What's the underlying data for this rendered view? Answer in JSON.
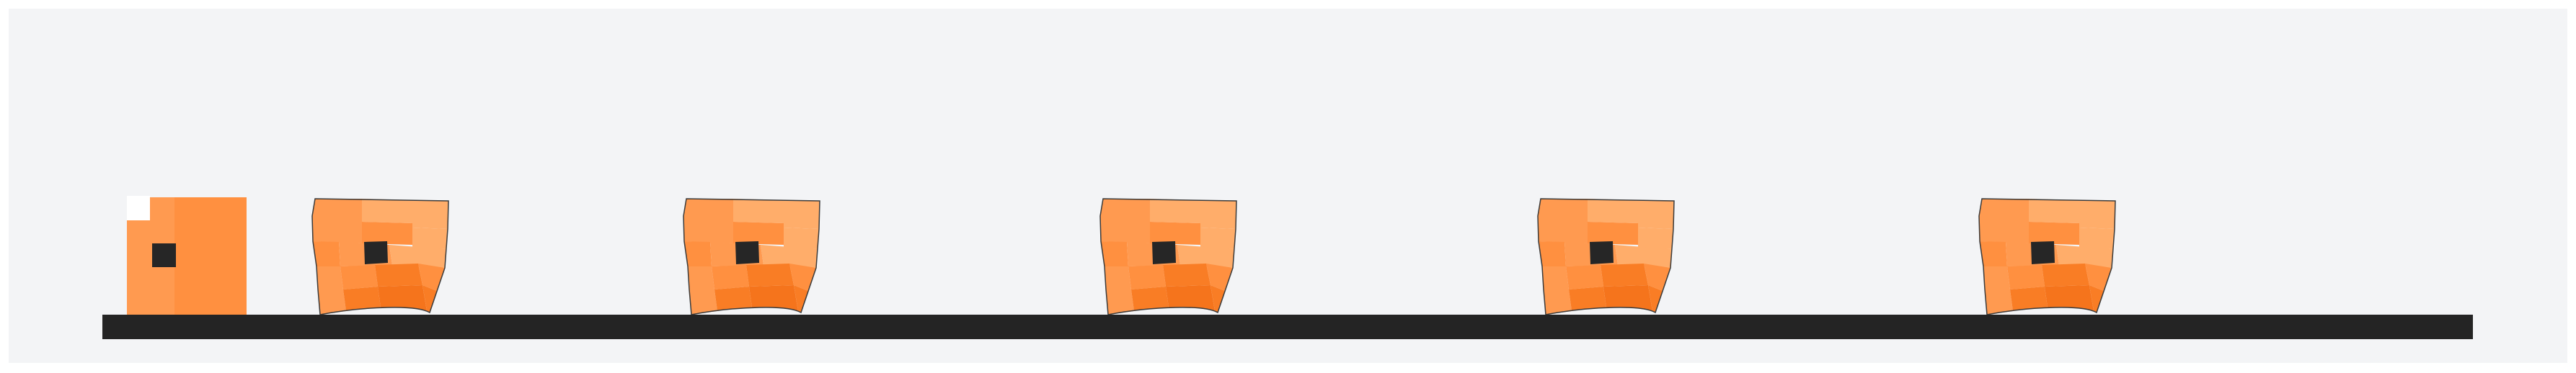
{
  "scene": {
    "background_color": "#f3f4f6",
    "frame_color": "#ffffff",
    "ground_color": "#242424",
    "hole_color": "#262626",
    "outline_color": "#3a3a3a",
    "palette": {
      "base": "#ff9040",
      "light": "#ffad6a",
      "mid": "#ff9a50",
      "dark": "#f97d25",
      "darker": "#f5741c"
    },
    "object_count": 6
  }
}
